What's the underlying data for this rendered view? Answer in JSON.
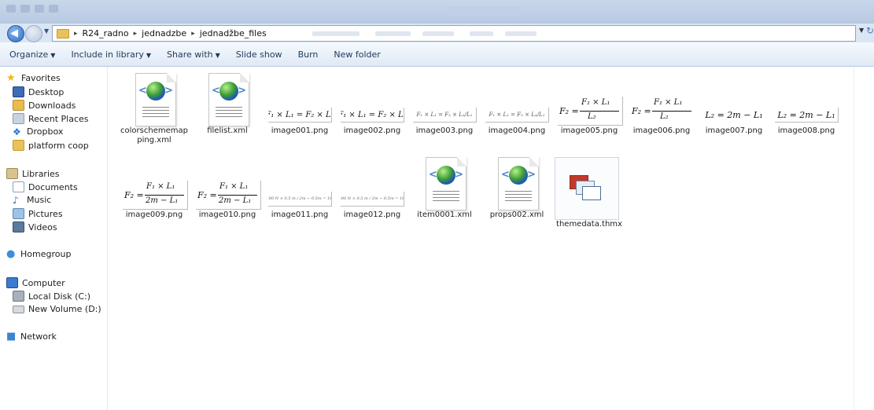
{
  "address": {
    "breadcrumbs": [
      "R24_radno",
      "jednadzbe",
      "jednadžbe_files"
    ],
    "separator": "▸"
  },
  "toolbar": {
    "organize": "Organize",
    "include_in_library": "Include in library",
    "share_with": "Share with",
    "slide_show": "Slide show",
    "burn": "Burn",
    "new_folder": "New folder"
  },
  "nav": {
    "favorites": "Favorites",
    "desktop": "Desktop",
    "downloads": "Downloads",
    "recent_places": "Recent Places",
    "dropbox": "Dropbox",
    "platform_coop": "platform coop",
    "libraries": "Libraries",
    "documents": "Documents",
    "music": "Music",
    "pictures": "Pictures",
    "videos": "Videos",
    "homegroup": "Homegroup",
    "computer": "Computer",
    "local_disk": "Local Disk (C:)",
    "new_volume": "New Volume (D:)",
    "network": "Network"
  },
  "files": [
    {
      "name": "colorschememapping.xml",
      "icon": "xml-globe-icon"
    },
    {
      "name": "filelist.xml",
      "icon": "xml-globe-icon"
    },
    {
      "name": "image001.png",
      "formula": "F₁ × L₁ = F₂ × L₂"
    },
    {
      "name": "image002.png",
      "formula": "F₁ × L₁ = F₂ × L₂"
    },
    {
      "name": "image003.png",
      "formula": "F₁ × L₁ = F₂ × L₂/L₁"
    },
    {
      "name": "image004.png",
      "formula": "F₁ × L₁ = F₂ × L₂/L₁"
    },
    {
      "name": "image005.png",
      "formula": {
        "lhs": "F₂ =",
        "num": "F₁ × L₁",
        "den": "L₂"
      }
    },
    {
      "name": "image006.png",
      "formula": {
        "lhs": "F₂ =",
        "num": "F₁ × L₁",
        "den": "L₂"
      }
    },
    {
      "name": "image007.png",
      "formula": "L₂ = 2m − L₁"
    },
    {
      "name": "image008.png",
      "formula": "L₂ = 2m − L₁"
    },
    {
      "name": "image009.png",
      "formula": {
        "lhs": "F₂ =",
        "num": "F₁ × L₁",
        "den": "2m − L₁"
      }
    },
    {
      "name": "image010.png",
      "formula": {
        "lhs": "F₂ =",
        "num": "F₁ × L₁",
        "den": "2m − L₁"
      }
    },
    {
      "name": "image011.png",
      "formula": "F₂ = 500 N × 0.5 m / 2m − 0.5m = 166,6 N"
    },
    {
      "name": "image012.png",
      "formula": "F₂ = 500 N × 0.5 m / 2m − 0.5m = 166,6 N"
    },
    {
      "name": "item0001.xml",
      "icon": "xml-globe-icon"
    },
    {
      "name": "props002.xml",
      "icon": "xml-globe-icon"
    },
    {
      "name": "themedata.thmx",
      "icon": "theme-file-icon"
    }
  ]
}
